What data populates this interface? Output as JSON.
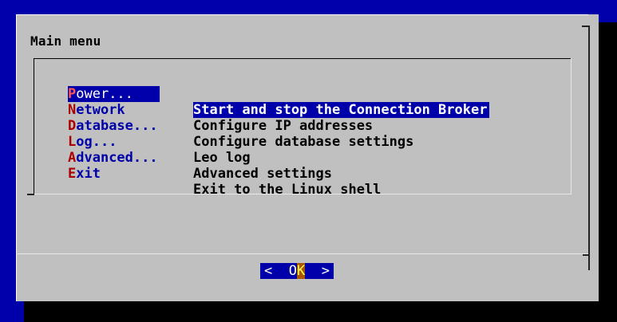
{
  "window": {
    "title": "Main menu"
  },
  "menu": {
    "items": [
      {
        "hotkey": "P",
        "rest": "ower...",
        "description": "Start and stop the Connection Broker",
        "selected": true
      },
      {
        "hotkey": "N",
        "rest": "etwork",
        "description": "Configure IP addresses",
        "selected": false
      },
      {
        "hotkey": "D",
        "rest": "atabase...",
        "description": "Configure database settings",
        "selected": false
      },
      {
        "hotkey": "L",
        "rest": "og...",
        "description": "Leo log",
        "selected": false
      },
      {
        "hotkey": "A",
        "rest": "dvanced...",
        "description": "Advanced settings",
        "selected": false
      },
      {
        "hotkey": "E",
        "rest": "xit",
        "description": "Exit to the Linux shell",
        "selected": false
      }
    ]
  },
  "buttons": {
    "ok": {
      "left_bracket": "<  ",
      "first": "O",
      "hot": "K",
      "right_bracket": "  >"
    }
  },
  "colors": {
    "background": "#0000aa",
    "dialog": "#c0c0c0",
    "hotkey": "#aa0000",
    "tag_text": "#0000aa",
    "selection": "#0000aa"
  }
}
